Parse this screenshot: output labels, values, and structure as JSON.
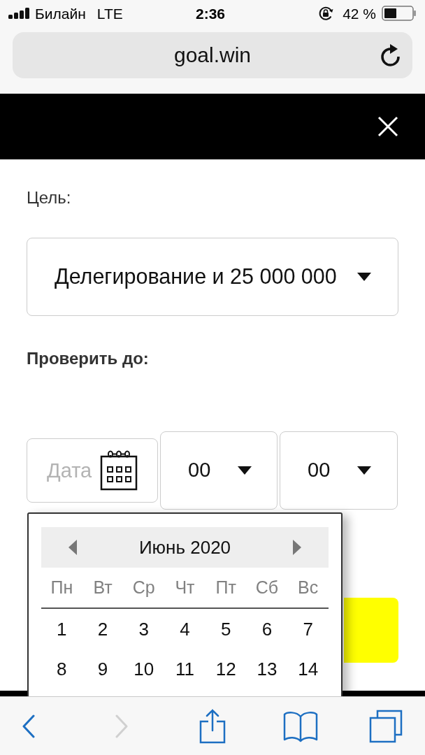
{
  "status_bar": {
    "carrier": "Билайн",
    "network": "LTE",
    "time": "2:36",
    "battery": "42 %"
  },
  "address_bar": {
    "url": "goal.win"
  },
  "form": {
    "goal": {
      "label": "Цель:",
      "value": "Делегирование и 25 000 000"
    },
    "deadline": {
      "label": "Проверить до:",
      "date": {
        "placeholder": "Дата"
      },
      "hour": {
        "value": "00"
      },
      "minute": {
        "value": "00"
      }
    }
  },
  "calendar": {
    "month": "Июнь 2020",
    "weekdays": [
      "Пн",
      "Вт",
      "Ср",
      "Чт",
      "Пт",
      "Сб",
      "Вс"
    ],
    "weeks": [
      [
        "1",
        "2",
        "3",
        "4",
        "5",
        "6",
        "7"
      ],
      [
        "8",
        "9",
        "10",
        "11",
        "12",
        "13",
        "14"
      ]
    ]
  },
  "toolbar": {
    "items": [
      {
        "kind": "back",
        "disabled": false
      },
      {
        "kind": "forward",
        "disabled": true
      },
      {
        "kind": "share",
        "disabled": false
      },
      {
        "kind": "bookmarks",
        "disabled": false
      },
      {
        "kind": "tabs",
        "disabled": false
      }
    ]
  }
}
